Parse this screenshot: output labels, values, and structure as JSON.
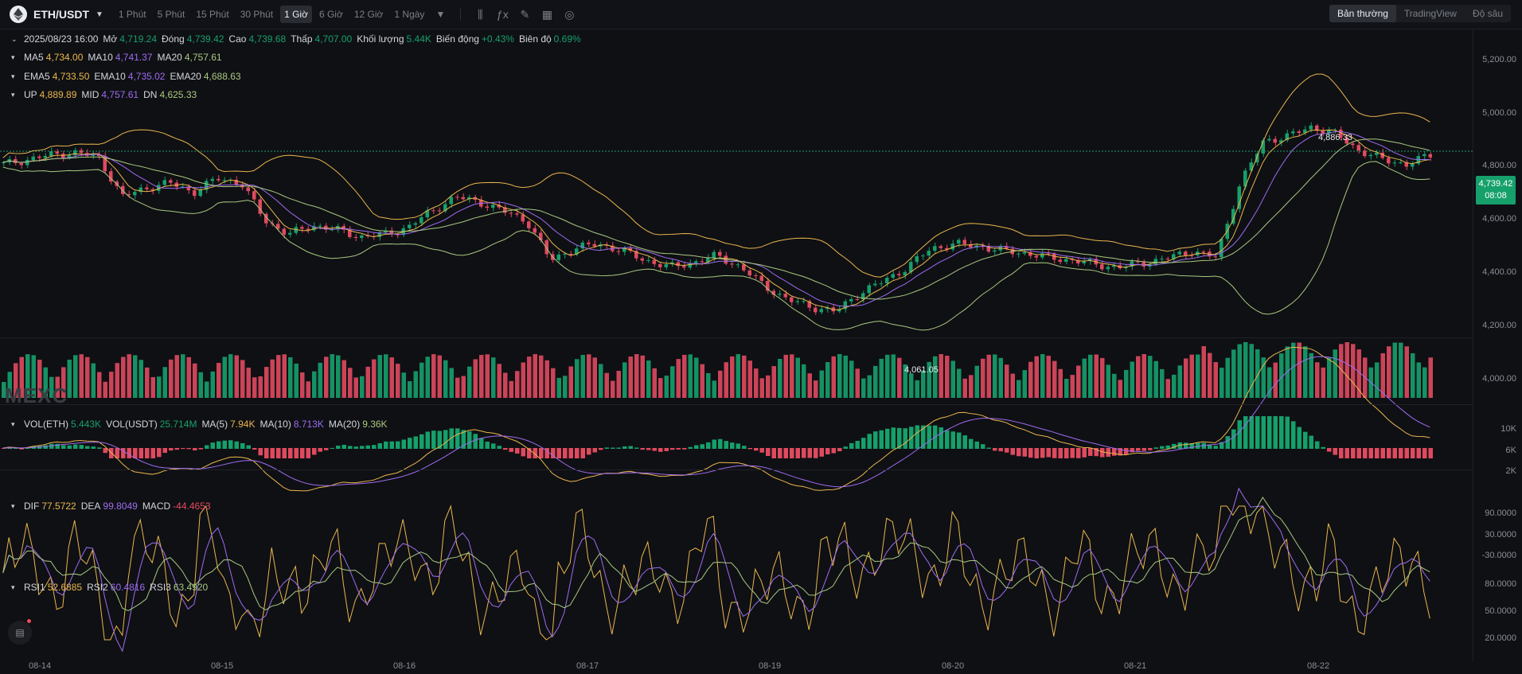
{
  "toolbar": {
    "pair": "ETH/USDT",
    "intervals": [
      "1 Phút",
      "5 Phút",
      "15 Phút",
      "30 Phút",
      "1 Giờ",
      "6 Giờ",
      "12 Giờ",
      "1 Ngày"
    ],
    "active_interval": "1 Giờ",
    "tools": [
      "candle-settings-icon",
      "indicator-icon",
      "draw-icon",
      "layout-icon",
      "camera-icon"
    ],
    "views": [
      "Bản thường",
      "TradingView",
      "Độ sâu"
    ],
    "active_view": "Bản thường"
  },
  "ohlc": {
    "date": "2025/08/23 16:00",
    "open_label": "Mở",
    "open": "4,719.24",
    "close_label": "Đóng",
    "close": "4,739.42",
    "high_label": "Cao",
    "high": "4,739.68",
    "low_label": "Thấp",
    "low": "4,707.00",
    "volume_label": "Khối lượng",
    "volume": "5.44K",
    "change_label": "Biến động",
    "change": "+0.43%",
    "amplitude_label": "Biên độ",
    "amplitude": "0.69%"
  },
  "ma": {
    "ma5_label": "MA5",
    "ma5": "4,734.00",
    "ma10_label": "MA10",
    "ma10": "4,741.37",
    "ma20_label": "MA20",
    "ma20": "4,757.61"
  },
  "ema": {
    "ema5_label": "EMA5",
    "ema5": "4,733.50",
    "ema10_label": "EMA10",
    "ema10": "4,735.02",
    "ema20_label": "EMA20",
    "ema20": "4,688.63"
  },
  "boll": {
    "up_label": "UP",
    "up": "4,889.89",
    "mid_label": "MID",
    "mid": "4,757.61",
    "dn_label": "DN",
    "dn": "4,625.33"
  },
  "vol": {
    "eth_label": "VOL(ETH)",
    "eth": "5.443K",
    "usdt_label": "VOL(USDT)",
    "usdt": "25.714M",
    "ma5_label": "MA(5)",
    "ma5": "7.94K",
    "ma10_label": "MA(10)",
    "ma10": "8.713K",
    "ma20_label": "MA(20)",
    "ma20": "9.36K"
  },
  "macd": {
    "dif_label": "DIF",
    "dif": "77.5722",
    "dea_label": "DEA",
    "dea": "99.8049",
    "macd_label": "MACD",
    "macd": "-44.4653"
  },
  "rsi": {
    "rsi1_label": "RSI1",
    "rsi1": "52.6885",
    "rsi2_label": "RSI2",
    "rsi2": "60.4816",
    "rsi3_label": "RSI3",
    "rsi3": "63.4920"
  },
  "price_axis": [
    "5,200.00",
    "5,000.00",
    "4,800.00",
    "4,600.00",
    "4,400.00",
    "4,200.00",
    "4,000.00"
  ],
  "vol_axis": [
    "10K",
    "6K",
    "2K"
  ],
  "macd_axis": [
    "90.0000",
    "30.0000",
    "-30.0000"
  ],
  "rsi_axis": [
    "80.0000",
    "50.0000",
    "20.0000"
  ],
  "dates": [
    "08-14",
    "08-15",
    "08-16",
    "08-17",
    "08-19",
    "08-20",
    "08-21",
    "08-22"
  ],
  "last_price": "4,739.42",
  "countdown": "08:08",
  "high_marker": "4,886.33",
  "low_marker": "4,061.05",
  "watermark": "MEXC",
  "colors": {
    "up": "#16a06b",
    "down": "#e04a5f",
    "ma5": "#e9b64c",
    "ma10": "#9d6cf0",
    "ma20": "#a8c97f",
    "boll": "#e9b64c",
    "bg": "#0f1014"
  },
  "chart_data": {
    "type": "candlestick",
    "price_range": [
      3960,
      5280
    ],
    "current": 4739.42,
    "high_point": 4886.33,
    "low_point": 4061.05,
    "trend": [
      4700,
      4720,
      4740,
      4750,
      4730,
      4560,
      4600,
      4620,
      4580,
      4640,
      4620,
      4460,
      4400,
      4440,
      4420,
      4390,
      4400,
      4430,
      4500,
      4560,
      4540,
      4500,
      4460,
      4290,
      4340,
      4360,
      4330,
      4290,
      4260,
      4280,
      4310,
      4260,
      4180,
      4120,
      4090,
      4070,
      4150,
      4200,
      4260,
      4340,
      4360,
      4350,
      4330,
      4320,
      4300,
      4290,
      4270,
      4260,
      4280,
      4300,
      4330,
      4300,
      4620,
      4800,
      4820,
      4860,
      4830,
      4760,
      4720,
      4700,
      4739
    ]
  }
}
